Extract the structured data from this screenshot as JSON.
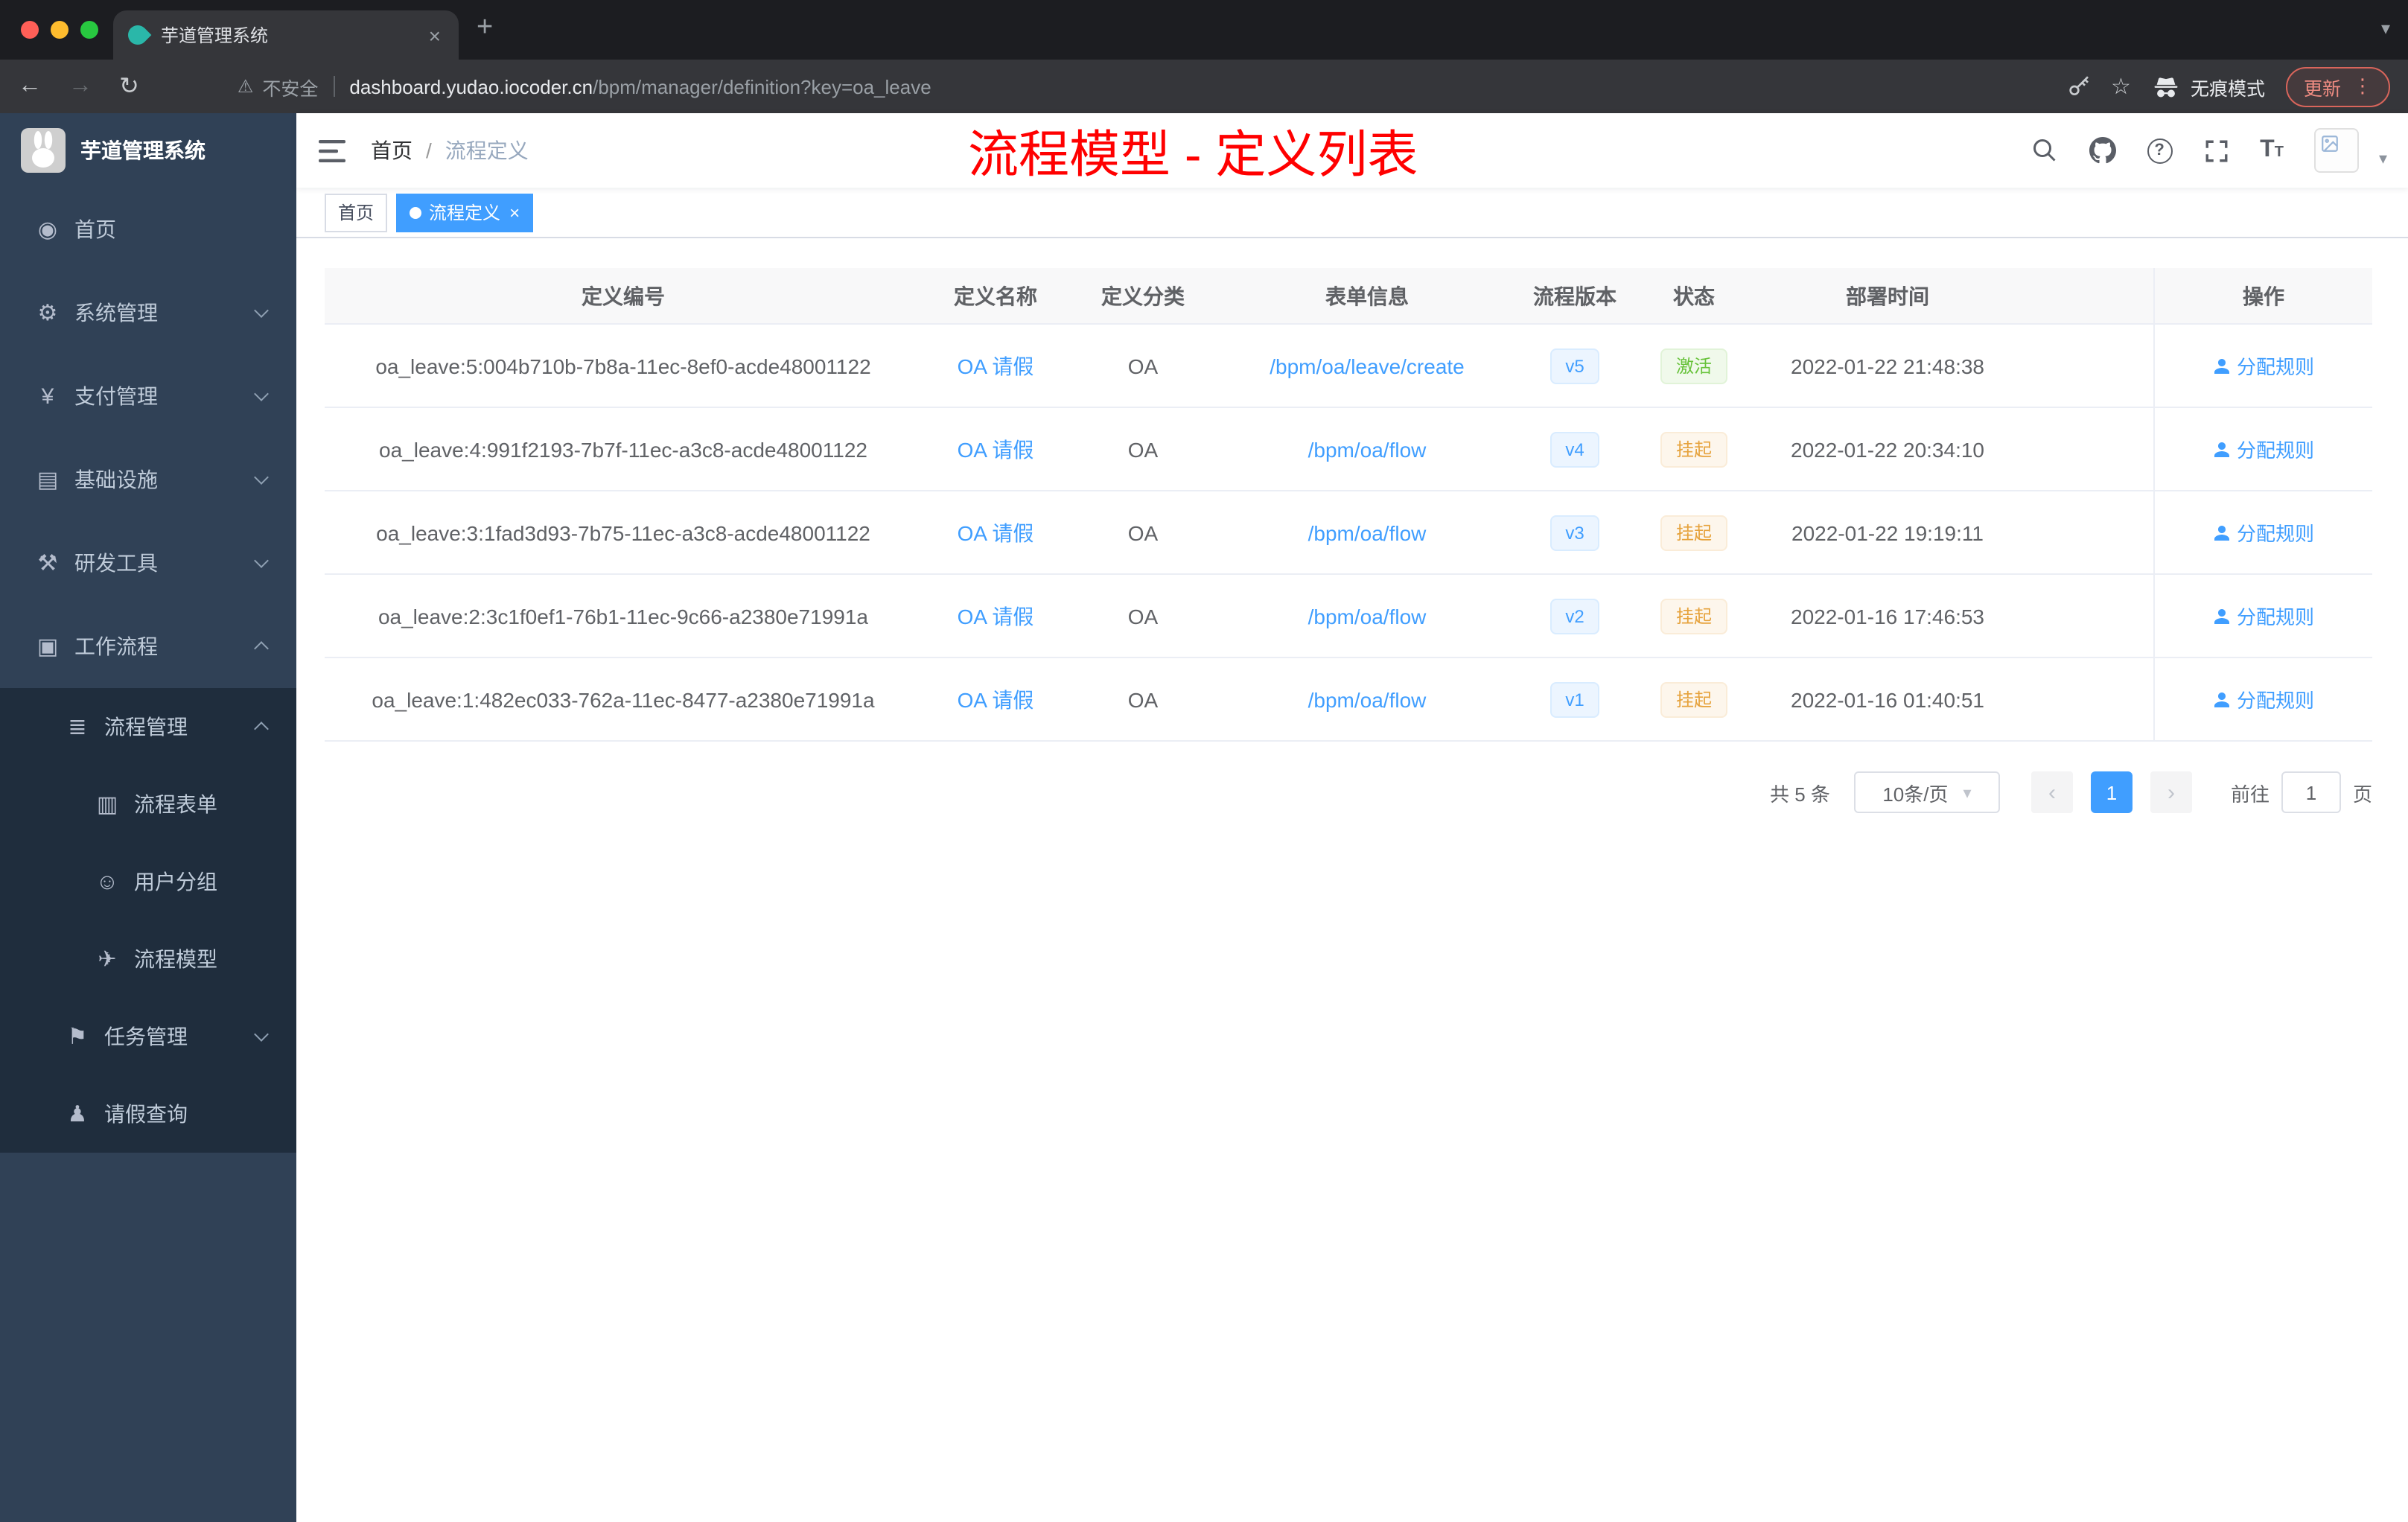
{
  "browser": {
    "tab_title": "芋道管理系统",
    "security_label": "不安全",
    "url_host": "dashboard.yudao.iocoder.cn",
    "url_path": "/bpm/manager/definition?key=oa_leave",
    "incognito_label": "无痕模式",
    "update_label": "更新"
  },
  "icons": {
    "back": "←",
    "forward": "→",
    "reload": "↻",
    "warning": "⚠",
    "star": "☆",
    "overflow": "⋮",
    "new_tab": "+",
    "tab_close": "×",
    "caret_down": "▾",
    "help": "?",
    "font_large": "T",
    "font_small": "T",
    "home": "◉",
    "system": "⚙",
    "pay": "¥",
    "infra": "▤",
    "dev": "⚒",
    "work": "▣",
    "flow_mgmt": "≣",
    "flow_form": "▥",
    "user_group": "☺",
    "flow_model": "✈",
    "task": "⚑",
    "leave": "♟",
    "prev": "‹",
    "next": "›"
  },
  "colors": {
    "accent": "#409eff",
    "success": "#67c23a",
    "warning": "#e6a23c",
    "title_red": "#ff0000",
    "sidebar_bg": "#304156",
    "submenu_bg": "#1f2d3d"
  },
  "sidebar": {
    "logo_title": "芋道管理系统",
    "items": [
      {
        "label": "首页"
      },
      {
        "label": "系统管理"
      },
      {
        "label": "支付管理"
      },
      {
        "label": "基础设施"
      },
      {
        "label": "研发工具"
      },
      {
        "label": "工作流程"
      },
      {
        "label": "流程管理"
      },
      {
        "label": "流程表单"
      },
      {
        "label": "用户分组"
      },
      {
        "label": "流程模型"
      },
      {
        "label": "任务管理"
      },
      {
        "label": "请假查询"
      }
    ]
  },
  "navbar": {
    "breadcrumb_home": "首页",
    "breadcrumb_sep": "/",
    "breadcrumb_current": "流程定义",
    "page_title": "流程模型 - 定义列表"
  },
  "tags": {
    "home": "首页",
    "current": "流程定义"
  },
  "table": {
    "columns": [
      "定义编号",
      "定义名称",
      "定义分类",
      "表单信息",
      "流程版本",
      "状态",
      "部署时间",
      "操作"
    ],
    "rows": [
      {
        "id": "oa_leave:5:004b710b-7b8a-11ec-8ef0-acde48001122",
        "name": "OA 请假",
        "category": "OA",
        "form": "/bpm/oa/leave/create",
        "version": "v5",
        "status": "激活",
        "time": "2022-01-22 21:48:38",
        "action": "分配规则"
      },
      {
        "id": "oa_leave:4:991f2193-7b7f-11ec-a3c8-acde48001122",
        "name": "OA 请假",
        "category": "OA",
        "form": "/bpm/oa/flow",
        "version": "v4",
        "status": "挂起",
        "time": "2022-01-22 20:34:10",
        "action": "分配规则"
      },
      {
        "id": "oa_leave:3:1fad3d93-7b75-11ec-a3c8-acde48001122",
        "name": "OA 请假",
        "category": "OA",
        "form": "/bpm/oa/flow",
        "version": "v3",
        "status": "挂起",
        "time": "2022-01-22 19:19:11",
        "action": "分配规则"
      },
      {
        "id": "oa_leave:2:3c1f0ef1-76b1-11ec-9c66-a2380e71991a",
        "name": "OA 请假",
        "category": "OA",
        "form": "/bpm/oa/flow",
        "version": "v2",
        "status": "挂起",
        "time": "2022-01-16 17:46:53",
        "action": "分配规则"
      },
      {
        "id": "oa_leave:1:482ec033-762a-11ec-8477-a2380e71991a",
        "name": "OA 请假",
        "category": "OA",
        "form": "/bpm/oa/flow",
        "version": "v1",
        "status": "挂起",
        "time": "2022-01-16 01:40:51",
        "action": "分配规则"
      }
    ]
  },
  "pagination": {
    "total": "共 5 条",
    "page_size": "10条/页",
    "page": "1",
    "goto": "前往",
    "goto_value": "1",
    "unit": "页"
  }
}
